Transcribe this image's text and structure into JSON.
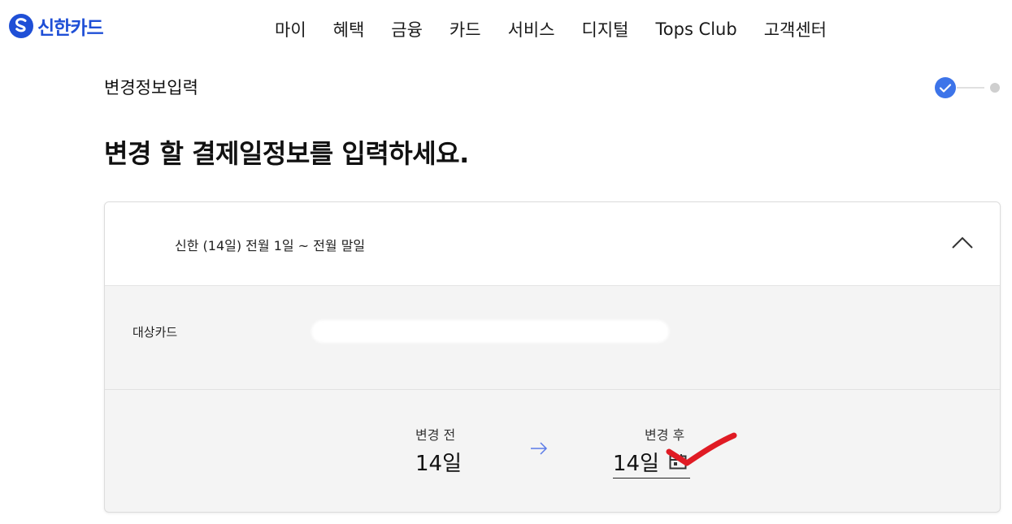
{
  "header": {
    "logo_text": "신한카드",
    "nav": [
      "마이",
      "혜택",
      "금융",
      "카드",
      "서비스",
      "디지털",
      "Tops Club",
      "고객센터"
    ]
  },
  "step": {
    "title": "변경정보입력",
    "total_steps": 2,
    "current_step": 1
  },
  "main_heading": "변경 할 결제일정보를 입력하세요.",
  "panel": {
    "summary": "신한 (14일) 전월 1일 ~ 전월 말일",
    "expanded": true,
    "target_card_label": "대상카드",
    "before_label": "변경 전",
    "before_value": "14일",
    "after_label": "변경 후",
    "after_value": "14일"
  },
  "colors": {
    "brand": "#1f4fd6",
    "step_active": "#3d74e9",
    "step_inactive": "#cfcfcf",
    "arrow": "#5b7be8",
    "annotation": "#e01b24"
  },
  "icons": {
    "logo": "shinhan-s-logo-icon",
    "chevron": "chevron-up-icon",
    "arrow": "arrow-right-icon",
    "calendar": "calendar-icon",
    "step_check": "check-icon"
  }
}
